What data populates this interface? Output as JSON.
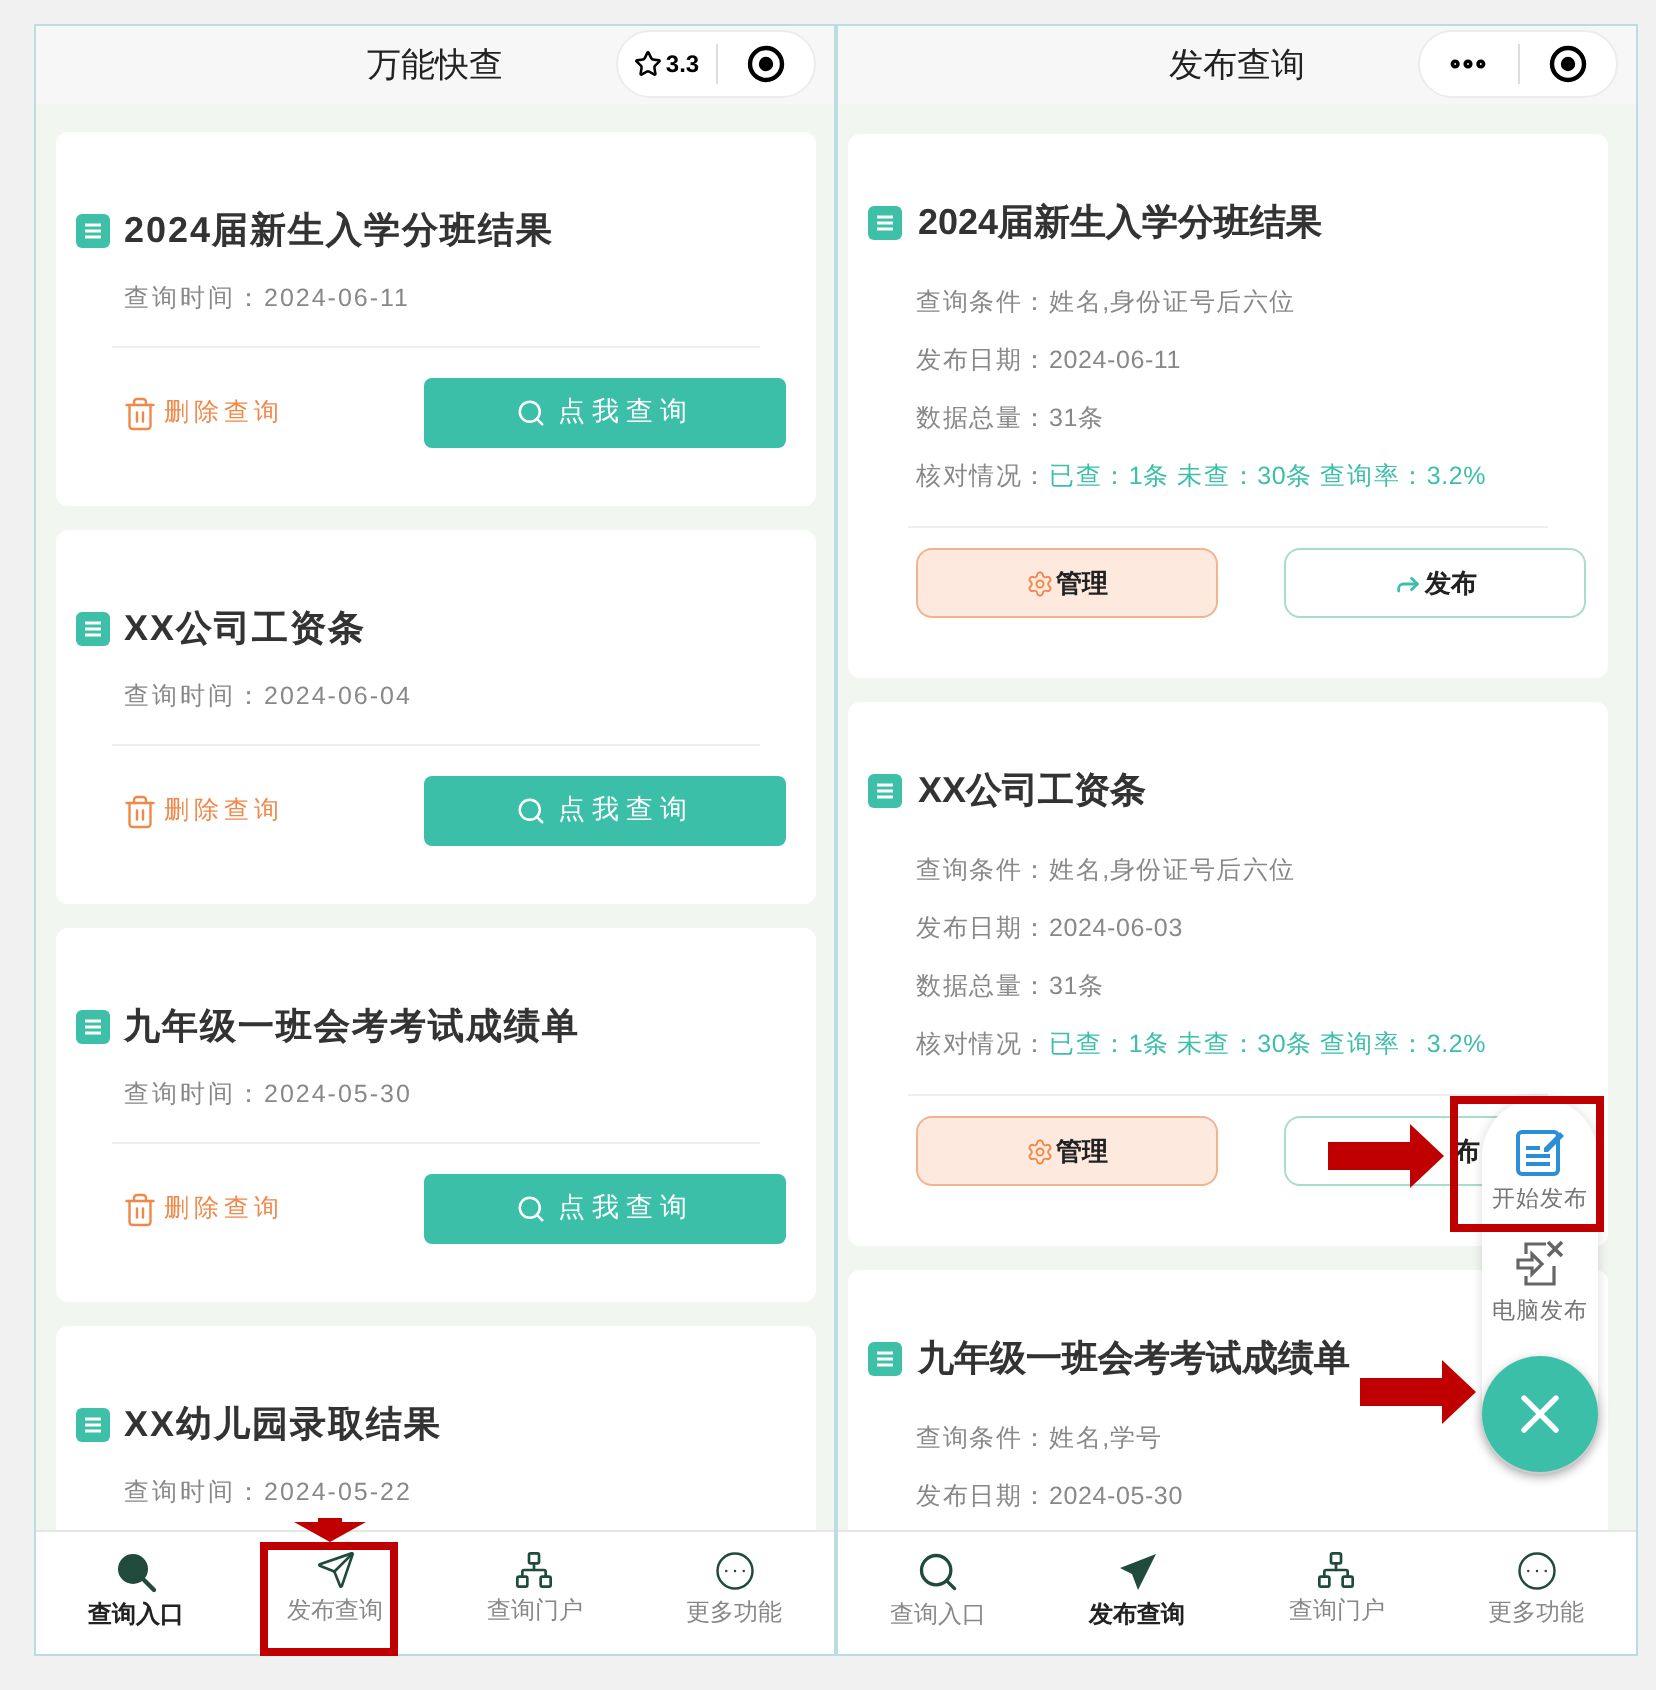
{
  "screens": [
    {
      "kind": "query_list",
      "title": "万能快查",
      "capsule": {
        "kind": "rating",
        "text": "3.3"
      },
      "cards": [
        {
          "title": "2024届新生入学分班结果",
          "time_label": "查询时间：",
          "time": "2024-06-11",
          "actions": {
            "delete": "删除查询",
            "query": "点我查询"
          }
        },
        {
          "title": "XX公司工资条",
          "time_label": "查询时间：",
          "time": "2024-06-04",
          "actions": {
            "delete": "删除查询",
            "query": "点我查询"
          }
        },
        {
          "title": "九年级一班会考考试成绩单",
          "time_label": "查询时间：",
          "time": "2024-05-30",
          "actions": {
            "delete": "删除查询",
            "query": "点我查询"
          }
        },
        {
          "title": "XX幼儿园录取结果",
          "time_label": "查询时间：",
          "time": "2024-05-22"
        }
      ],
      "tabs": [
        {
          "label": "查询入口",
          "kind": "search",
          "selected": true
        },
        {
          "label": "发布查询",
          "kind": "send",
          "selected": false
        },
        {
          "label": "查询门户",
          "kind": "portal",
          "selected": false
        },
        {
          "label": "更多功能",
          "kind": "more",
          "selected": false
        }
      ]
    },
    {
      "kind": "publish_list",
      "title": "发布查询",
      "capsule": {
        "kind": "more"
      },
      "cards": [
        {
          "title": "2024届新生入学分班结果",
          "fields": [
            {
              "label": "查询条件：",
              "value": "姓名,身份证号后六位"
            },
            {
              "label": "发布日期：",
              "value": "2024-06-11"
            },
            {
              "label": "数据总量：",
              "value": "31条"
            }
          ],
          "check": {
            "label": "核对情况：",
            "value": "已查：1条 未查：30条 查询率：3.2%"
          },
          "actions": {
            "manage": "管理",
            "publish": "发布",
            "publish_icon": true
          }
        },
        {
          "title": "XX公司工资条",
          "fields": [
            {
              "label": "查询条件：",
              "value": "姓名,身份证号后六位"
            },
            {
              "label": "发布日期：",
              "value": "2024-06-03"
            },
            {
              "label": "数据总量：",
              "value": "31条"
            }
          ],
          "check": {
            "label": "核对情况：",
            "value": "已查：1条 未查：30条 查询率：3.2%"
          },
          "actions": {
            "manage": "管理",
            "publish": "布",
            "publish_icon": false
          }
        },
        {
          "title": "九年级一班会考考试成绩单",
          "fields": [
            {
              "label": "查询条件：",
              "value": "姓名,学号"
            },
            {
              "label": "发布日期：",
              "value": "2024-05-30"
            }
          ]
        }
      ],
      "fab_menu": {
        "open": true,
        "items": [
          {
            "label": "开始发布",
            "kind": "edit"
          },
          {
            "label": "电脑发布",
            "kind": "computer"
          }
        ]
      },
      "tabs": [
        {
          "label": "查询入口",
          "kind": "search",
          "selected": false
        },
        {
          "label": "发布查询",
          "kind": "send",
          "selected": true
        },
        {
          "label": "查询门户",
          "kind": "portal",
          "selected": false
        },
        {
          "label": "更多功能",
          "kind": "more",
          "selected": false
        }
      ]
    }
  ]
}
